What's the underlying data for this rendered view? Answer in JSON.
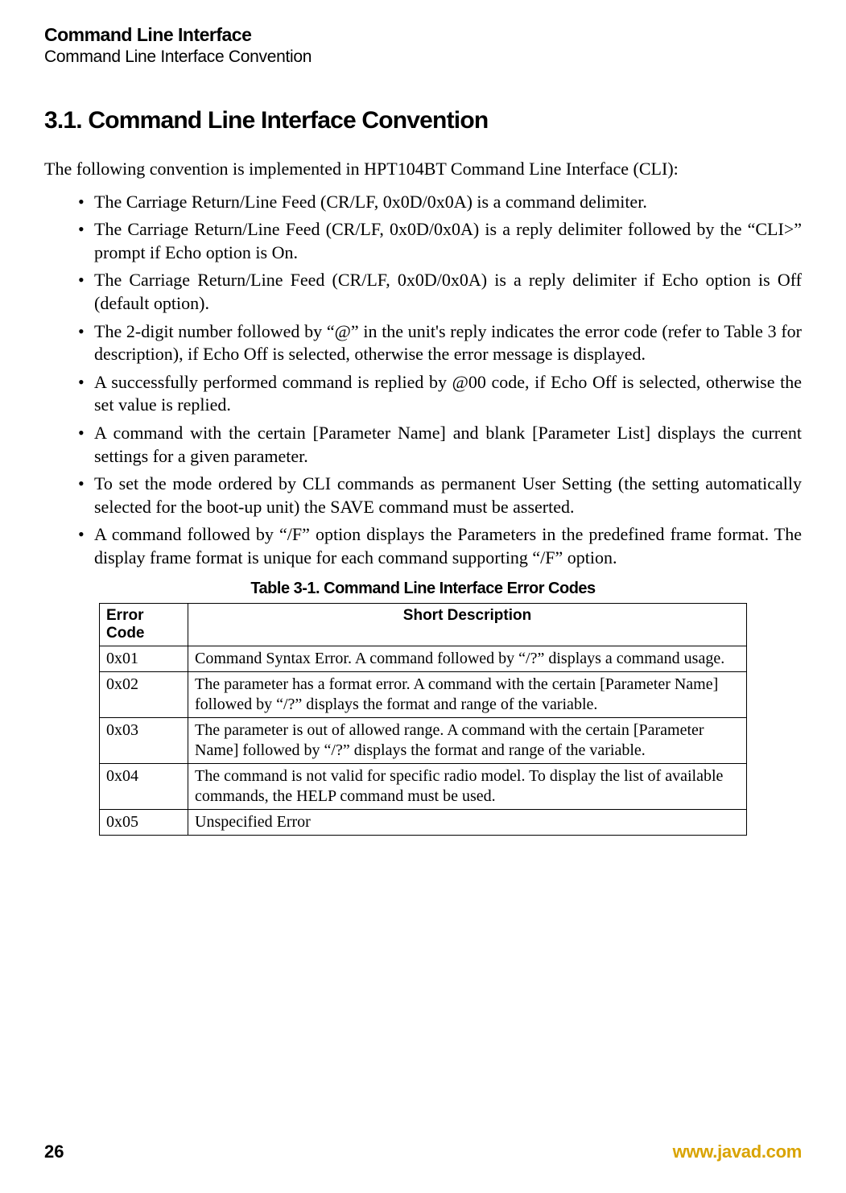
{
  "header": {
    "title": "Command Line Interface",
    "subtitle": "Command Line Interface Convention"
  },
  "section": {
    "heading": "3.1. Command Line Interface Convention",
    "intro": "The following convention is implemented in HPT104BT Command Line Interface (CLI):",
    "bullets": [
      "The Carriage Return/Line Feed (CR/LF, 0x0D/0x0A) is a command delimiter.",
      "The Carriage Return/Line Feed (CR/LF, 0x0D/0x0A) is a reply delimiter followed by the “CLI>” prompt if Echo option is On.",
      "The Carriage Return/Line Feed (CR/LF, 0x0D/0x0A) is a reply delimiter if Echo option is Off (default option).",
      "The 2-digit number followed by “@” in the unit's reply indicates the error code (refer to Table 3 for description), if Echo Off is selected, otherwise the error message is displayed.",
      "A successfully performed command is replied by @00 code, if Echo Off is selected, otherwise the set value is replied.",
      "A command with the certain [Parameter Name] and blank [Parameter List] displays the current settings for a given parameter.",
      "To set the mode ordered by CLI commands as permanent User Setting (the setting automatically selected for the boot-up unit) the SAVE command must be asserted.",
      "A command followed by “/F” option displays the Parameters in the predefined frame format. The display frame format is unique for each command supporting “/F” option."
    ]
  },
  "table": {
    "caption": "Table 3-1. Command Line Interface Error Codes",
    "headers": {
      "code": "Error Code",
      "desc": "Short Description"
    },
    "rows": [
      {
        "code": "0x01",
        "desc": "Command Syntax Error. A command followed by “/?” displays a command usage."
      },
      {
        "code": "0x02",
        "desc": "The parameter has a format error. A command with the certain [Parameter Name] followed by “/?” displays the format and range of the variable."
      },
      {
        "code": "0x03",
        "desc": "The parameter is out of allowed range. A command with the certain [Parameter Name] followed by “/?” displays the format and range of the variable."
      },
      {
        "code": "0x04",
        "desc": "The command is not valid for specific radio model. To display the list of available commands, the HELP command must be used."
      },
      {
        "code": "0x05",
        "desc": "Unspecified Error"
      }
    ]
  },
  "footer": {
    "page": "26",
    "url": "www.javad.com"
  }
}
